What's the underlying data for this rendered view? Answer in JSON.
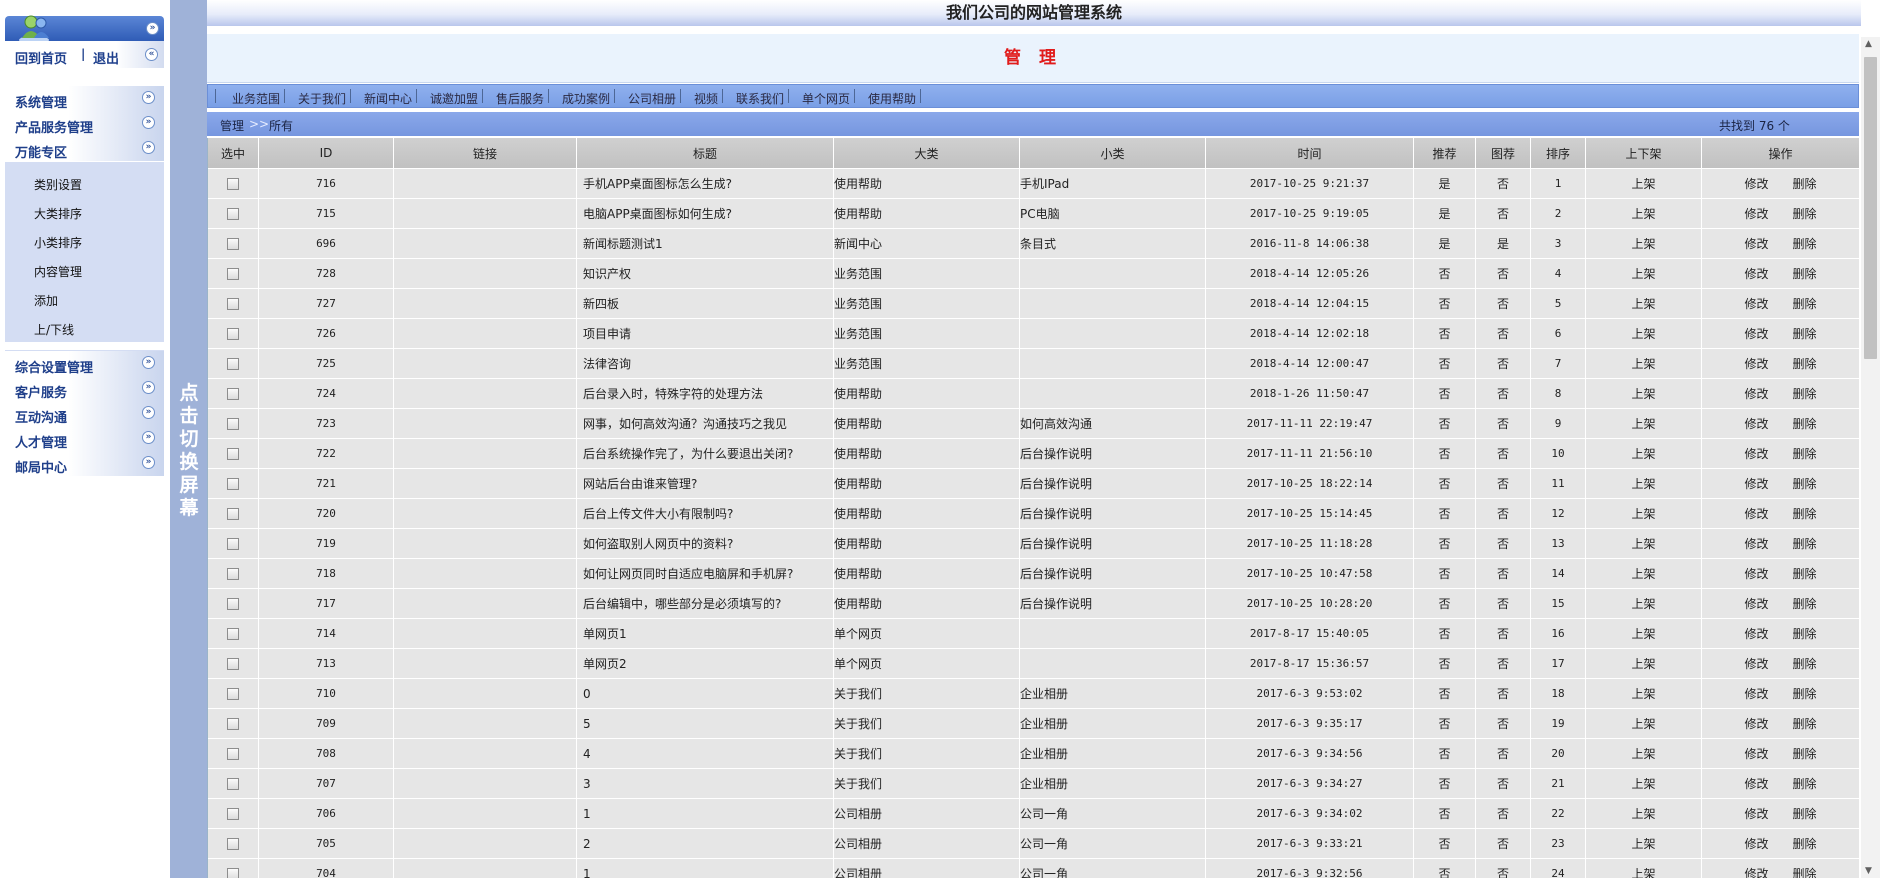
{
  "app": {
    "title": "我们公司的网站管理系统",
    "panel_title": "管 理"
  },
  "sidebar": {
    "home_link": "回到首页",
    "separator": "|",
    "logout_link": "退出",
    "groups_top": [
      "系统管理",
      "产品服务管理",
      "万能专区"
    ],
    "submenu": [
      "类别设置",
      "大类排序",
      "小类排序",
      "内容管理",
      "添加",
      "上/下线"
    ],
    "groups_bottom": [
      "综合设置管理",
      "客户服务",
      "互动沟通",
      "人才管理",
      "邮局中心"
    ]
  },
  "switch_bar": {
    "label": "点击切换屏幕"
  },
  "tabs": [
    "业务范围",
    "关于我们",
    "新闻中心",
    "诚邀加盟",
    "售后服务",
    "成功案例",
    "公司相册",
    "视频",
    "联系我们",
    "单个网页",
    "使用帮助"
  ],
  "breadcrumb": {
    "root": "管理",
    "arrow": ">>",
    "current": "所有",
    "count_text": "共找到 76 个"
  },
  "table": {
    "headers": [
      "选中",
      "ID",
      "链接",
      "标题",
      "大类",
      "小类",
      "时间",
      "推荐",
      "图荐",
      "排序",
      "上下架",
      "操作"
    ],
    "edit_label": "修改",
    "delete_label": "删除",
    "rows": [
      {
        "id": "716",
        "title": "手机APP桌面图标怎么生成?",
        "big": "使用帮助",
        "small": "手机IPad",
        "time": "2017-10-25 9:21:37",
        "rec": "是",
        "img": "否",
        "sort": "1",
        "status": "上架"
      },
      {
        "id": "715",
        "title": "电脑APP桌面图标如何生成?",
        "big": "使用帮助",
        "small": "PC电脑",
        "time": "2017-10-25 9:19:05",
        "rec": "是",
        "img": "否",
        "sort": "2",
        "status": "上架"
      },
      {
        "id": "696",
        "title": "新闻标题测试1",
        "big": "新闻中心",
        "small": "条目式",
        "time": "2016-11-8 14:06:38",
        "rec": "是",
        "img": "是",
        "sort": "3",
        "status": "上架"
      },
      {
        "id": "728",
        "title": "知识产权",
        "big": "业务范围",
        "small": "",
        "time": "2018-4-14 12:05:26",
        "rec": "否",
        "img": "否",
        "sort": "4",
        "status": "上架"
      },
      {
        "id": "727",
        "title": "新四板",
        "big": "业务范围",
        "small": "",
        "time": "2018-4-14 12:04:15",
        "rec": "否",
        "img": "否",
        "sort": "5",
        "status": "上架"
      },
      {
        "id": "726",
        "title": "项目申请",
        "big": "业务范围",
        "small": "",
        "time": "2018-4-14 12:02:18",
        "rec": "否",
        "img": "否",
        "sort": "6",
        "status": "上架"
      },
      {
        "id": "725",
        "title": "法律咨询",
        "big": "业务范围",
        "small": "",
        "time": "2018-4-14 12:00:47",
        "rec": "否",
        "img": "否",
        "sort": "7",
        "status": "上架"
      },
      {
        "id": "724",
        "title": "后台录入时，特殊字符的处理方法",
        "big": "使用帮助",
        "small": "",
        "time": "2018-1-26 11:50:47",
        "rec": "否",
        "img": "否",
        "sort": "8",
        "status": "上架"
      },
      {
        "id": "723",
        "title": "网事，如何高效沟通？沟通技巧之我见",
        "big": "使用帮助",
        "small": "如何高效沟通",
        "time": "2017-11-11 22:19:47",
        "rec": "否",
        "img": "否",
        "sort": "9",
        "status": "上架"
      },
      {
        "id": "722",
        "title": "后台系统操作完了，为什么要退出关闭?",
        "big": "使用帮助",
        "small": "后台操作说明",
        "time": "2017-11-11 21:56:10",
        "rec": "否",
        "img": "否",
        "sort": "10",
        "status": "上架"
      },
      {
        "id": "721",
        "title": "网站后台由谁来管理?",
        "big": "使用帮助",
        "small": "后台操作说明",
        "time": "2017-10-25 18:22:14",
        "rec": "否",
        "img": "否",
        "sort": "11",
        "status": "上架"
      },
      {
        "id": "720",
        "title": "后台上传文件大小有限制吗?",
        "big": "使用帮助",
        "small": "后台操作说明",
        "time": "2017-10-25 15:14:45",
        "rec": "否",
        "img": "否",
        "sort": "12",
        "status": "上架"
      },
      {
        "id": "719",
        "title": "如何盗取别人网页中的资料?",
        "big": "使用帮助",
        "small": "后台操作说明",
        "time": "2017-10-25 11:18:28",
        "rec": "否",
        "img": "否",
        "sort": "13",
        "status": "上架"
      },
      {
        "id": "718",
        "title": "如何让网页同时自适应电脑屏和手机屏?",
        "big": "使用帮助",
        "small": "后台操作说明",
        "time": "2017-10-25 10:47:58",
        "rec": "否",
        "img": "否",
        "sort": "14",
        "status": "上架"
      },
      {
        "id": "717",
        "title": "后台编辑中，哪些部分是必须填写的?",
        "big": "使用帮助",
        "small": "后台操作说明",
        "time": "2017-10-25 10:28:20",
        "rec": "否",
        "img": "否",
        "sort": "15",
        "status": "上架"
      },
      {
        "id": "714",
        "title": "单网页1",
        "big": "单个网页",
        "small": "",
        "time": "2017-8-17 15:40:05",
        "rec": "否",
        "img": "否",
        "sort": "16",
        "status": "上架"
      },
      {
        "id": "713",
        "title": "单网页2",
        "big": "单个网页",
        "small": "",
        "time": "2017-8-17 15:36:57",
        "rec": "否",
        "img": "否",
        "sort": "17",
        "status": "上架"
      },
      {
        "id": "710",
        "title": "0",
        "big": "关于我们",
        "small": "企业相册",
        "time": "2017-6-3 9:53:02",
        "rec": "否",
        "img": "否",
        "sort": "18",
        "status": "上架"
      },
      {
        "id": "709",
        "title": "5",
        "big": "关于我们",
        "small": "企业相册",
        "time": "2017-6-3 9:35:17",
        "rec": "否",
        "img": "否",
        "sort": "19",
        "status": "上架"
      },
      {
        "id": "708",
        "title": "4",
        "big": "关于我们",
        "small": "企业相册",
        "time": "2017-6-3 9:34:56",
        "rec": "否",
        "img": "否",
        "sort": "20",
        "status": "上架"
      },
      {
        "id": "707",
        "title": "3",
        "big": "关于我们",
        "small": "企业相册",
        "time": "2017-6-3 9:34:27",
        "rec": "否",
        "img": "否",
        "sort": "21",
        "status": "上架"
      },
      {
        "id": "706",
        "title": "1",
        "big": "公司相册",
        "small": "公司一角",
        "time": "2017-6-3 9:34:02",
        "rec": "否",
        "img": "否",
        "sort": "22",
        "status": "上架"
      },
      {
        "id": "705",
        "title": "2",
        "big": "公司相册",
        "small": "公司一角",
        "time": "2017-6-3 9:33:21",
        "rec": "否",
        "img": "否",
        "sort": "23",
        "status": "上架"
      },
      {
        "id": "704",
        "title": "1",
        "big": "公司相册",
        "small": "公司一角",
        "time": "2017-6-3 9:32:56",
        "rec": "否",
        "img": "否",
        "sort": "24",
        "status": "上架"
      }
    ]
  },
  "icons": {
    "logo": "users-logo-icon",
    "expand": "double-chevron-down-icon",
    "collapse": "double-chevron-left-icon"
  },
  "colors": {
    "panel_title": "#e11b1b",
    "nav_link": "#1e3f8c",
    "tabbar": "#7a9fe6",
    "switchbar": "#9fb2d8"
  }
}
